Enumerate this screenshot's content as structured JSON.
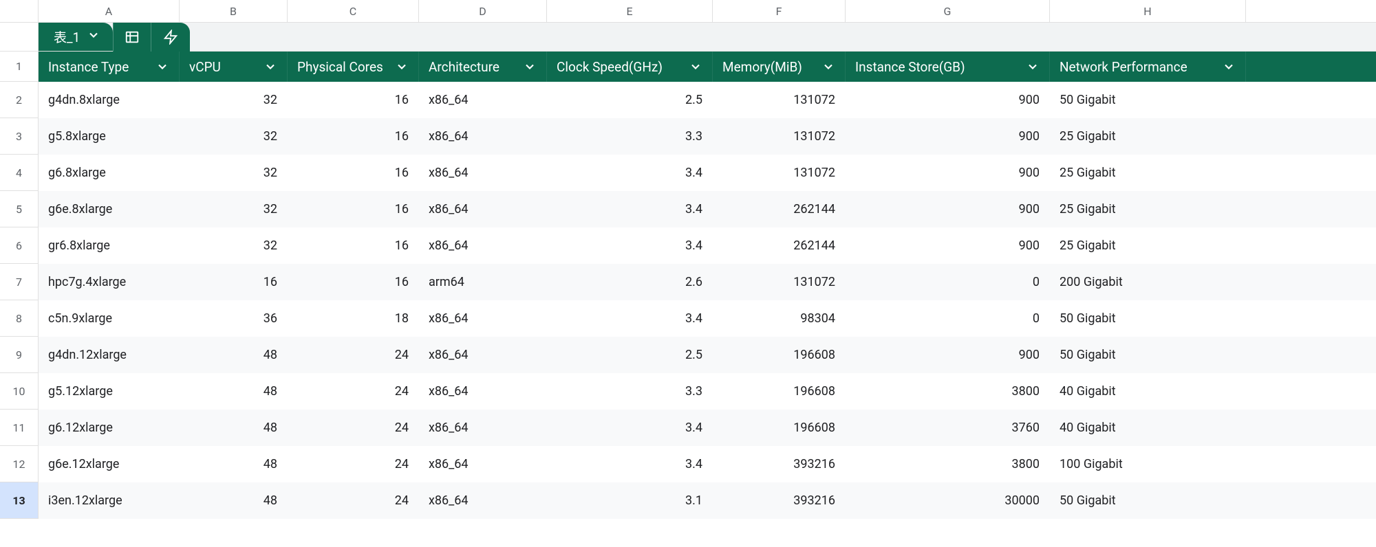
{
  "sheet_tab": {
    "name": "表_1"
  },
  "col_letters": [
    "A",
    "B",
    "C",
    "D",
    "E",
    "F",
    "G",
    "H"
  ],
  "headers": [
    {
      "label": "Instance Type",
      "align": "text"
    },
    {
      "label": "vCPU",
      "align": "num"
    },
    {
      "label": "Physical Cores",
      "align": "num"
    },
    {
      "label": "Architecture",
      "align": "text"
    },
    {
      "label": "Clock Speed(GHz)",
      "align": "num"
    },
    {
      "label": "Memory(MiB)",
      "align": "num"
    },
    {
      "label": "Instance Store(GB)",
      "align": "num"
    },
    {
      "label": "Network Performance",
      "align": "text"
    }
  ],
  "rows": [
    {
      "n": "2",
      "cells": [
        "g4dn.8xlarge",
        "32",
        "16",
        "x86_64",
        "2.5",
        "131072",
        "900",
        "50 Gigabit"
      ]
    },
    {
      "n": "3",
      "cells": [
        "g5.8xlarge",
        "32",
        "16",
        "x86_64",
        "3.3",
        "131072",
        "900",
        "25 Gigabit"
      ]
    },
    {
      "n": "4",
      "cells": [
        "g6.8xlarge",
        "32",
        "16",
        "x86_64",
        "3.4",
        "131072",
        "900",
        "25 Gigabit"
      ]
    },
    {
      "n": "5",
      "cells": [
        "g6e.8xlarge",
        "32",
        "16",
        "x86_64",
        "3.4",
        "262144",
        "900",
        "25 Gigabit"
      ]
    },
    {
      "n": "6",
      "cells": [
        "gr6.8xlarge",
        "32",
        "16",
        "x86_64",
        "3.4",
        "262144",
        "900",
        "25 Gigabit"
      ]
    },
    {
      "n": "7",
      "cells": [
        "hpc7g.4xlarge",
        "16",
        "16",
        "arm64",
        "2.6",
        "131072",
        "0",
        "200 Gigabit"
      ]
    },
    {
      "n": "8",
      "cells": [
        "c5n.9xlarge",
        "36",
        "18",
        "x86_64",
        "3.4",
        "98304",
        "0",
        "50 Gigabit"
      ]
    },
    {
      "n": "9",
      "cells": [
        "g4dn.12xlarge",
        "48",
        "24",
        "x86_64",
        "2.5",
        "196608",
        "900",
        "50 Gigabit"
      ]
    },
    {
      "n": "10",
      "cells": [
        "g5.12xlarge",
        "48",
        "24",
        "x86_64",
        "3.3",
        "196608",
        "3800",
        "40 Gigabit"
      ]
    },
    {
      "n": "11",
      "cells": [
        "g6.12xlarge",
        "48",
        "24",
        "x86_64",
        "3.4",
        "196608",
        "3760",
        "40 Gigabit"
      ]
    },
    {
      "n": "12",
      "cells": [
        "g6e.12xlarge",
        "48",
        "24",
        "x86_64",
        "3.4",
        "393216",
        "3800",
        "100 Gigabit"
      ]
    },
    {
      "n": "13",
      "cells": [
        "i3en.12xlarge",
        "48",
        "24",
        "x86_64",
        "3.1",
        "393216",
        "30000",
        "50 Gigabit"
      ],
      "selected": true
    }
  ],
  "col_classes": [
    "col-A",
    "col-B",
    "col-C",
    "col-D",
    "col-E",
    "col-F",
    "col-G",
    "col-H"
  ],
  "col_align": [
    "text",
    "num",
    "num",
    "text",
    "num",
    "num",
    "num",
    "text"
  ]
}
